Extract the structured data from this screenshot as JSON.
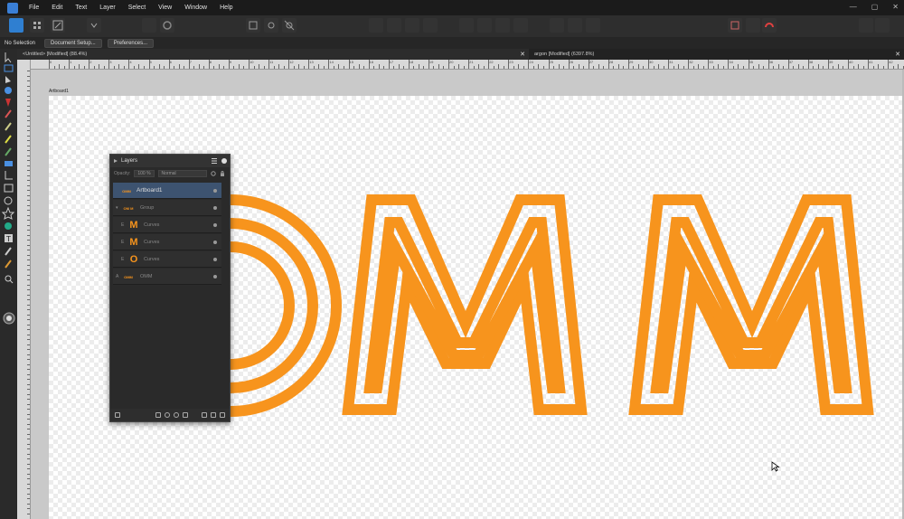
{
  "menubar": {
    "items": [
      "File",
      "Edit",
      "Text",
      "Layer",
      "Select",
      "View",
      "Window",
      "Help"
    ],
    "window_controls": [
      "—",
      "▢",
      "✕"
    ]
  },
  "contextbar": {
    "status": "No Selection",
    "document_setup": "Document Setup...",
    "preferences": "Preferences..."
  },
  "tabs": [
    {
      "label": "<Untitled> [Modified] (88.4%)",
      "close": "✕"
    },
    {
      "label": "argon [Modified] (6397.8%)",
      "close": "✕"
    }
  ],
  "ruler_top": [
    "0",
    "1",
    "2",
    "3",
    "4",
    "5",
    "6",
    "7",
    "8",
    "9",
    "10",
    "11",
    "12",
    "13",
    "14",
    "15",
    "16",
    "17",
    "18",
    "19",
    "20",
    "21",
    "22",
    "23",
    "24",
    "25",
    "26",
    "27",
    "28",
    "29",
    "30",
    "31",
    "32",
    "33",
    "34",
    "35",
    "36",
    "37",
    "38",
    "39",
    "40",
    "41",
    "42",
    "43"
  ],
  "artboard": {
    "label": "Artboard1"
  },
  "layers_panel": {
    "title": "Layers",
    "opacity_label": "Opacity:",
    "opacity_value": "100 %",
    "blend_mode": "Normal",
    "rows": [
      {
        "thumb": "OMM",
        "name": "Artboard1",
        "selected": true,
        "indicator": ""
      },
      {
        "thumb": "OM M",
        "name": "Group",
        "selected": false,
        "indicator": "▾"
      },
      {
        "thumb": "M",
        "name": "Curves",
        "selected": false,
        "indicator": "E"
      },
      {
        "thumb": "M",
        "name": "Curves",
        "selected": false,
        "indicator": "E"
      },
      {
        "thumb": "O",
        "name": "Curves",
        "selected": false,
        "indicator": "E"
      },
      {
        "thumb": "OMM",
        "name": "OMM",
        "selected": false,
        "indicator": "A"
      }
    ]
  },
  "colors": {
    "accent_orange": "#F7941D",
    "selection_blue": "#3D5370"
  }
}
